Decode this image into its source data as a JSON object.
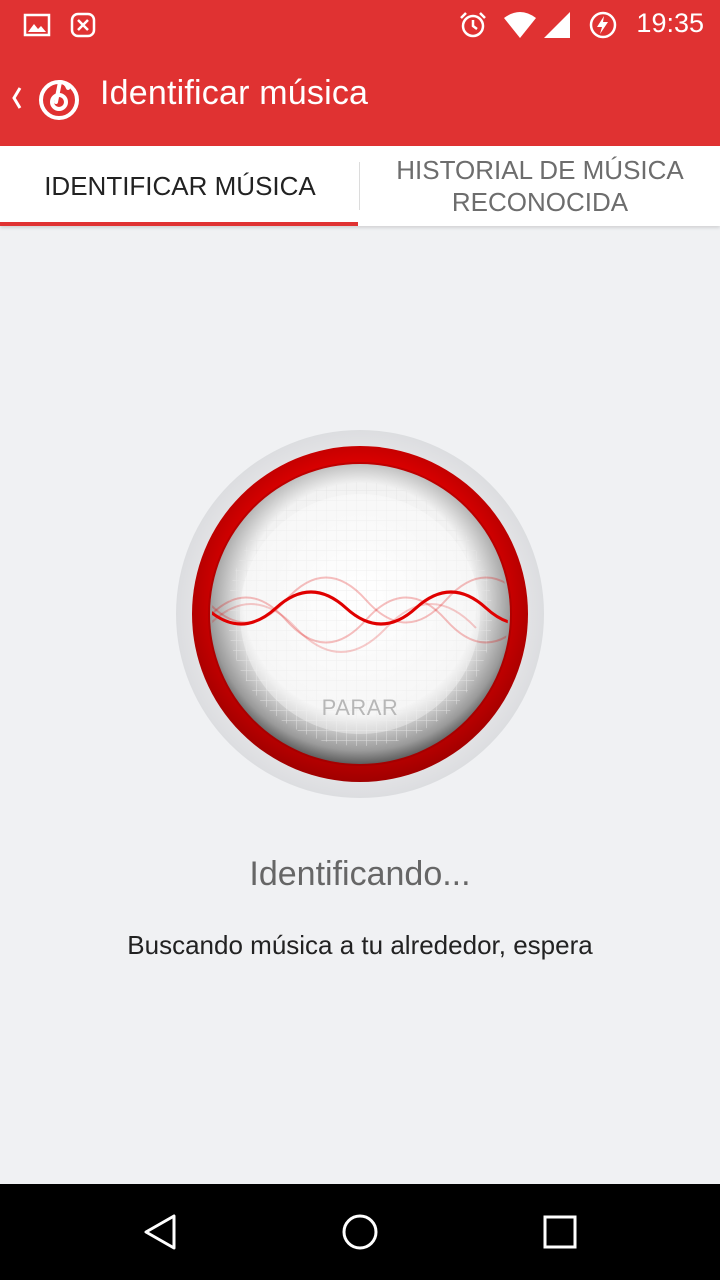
{
  "statusbar": {
    "time": "19:35",
    "icons": [
      "image-notification-icon",
      "app-notification-icon",
      "alarm-icon",
      "wifi-icon",
      "signal-icon",
      "battery-charging-icon"
    ]
  },
  "appbar": {
    "title": "Identificar música",
    "back_icon": "back-chevron-icon",
    "logo_icon": "app-logo-icon",
    "background": "#e03232"
  },
  "tabs": [
    {
      "label": "IDENTIFICAR MÚSICA",
      "active": true
    },
    {
      "label": "HISTORIAL DE MÚSICA RECONOCIDA",
      "active": false
    }
  ],
  "recognizer": {
    "stop_label": "PARAR",
    "accent": "#e00000"
  },
  "status": {
    "title": "Identificando...",
    "subtitle": "Buscando música a tu alrededor, espera"
  },
  "navbar": {
    "icons": [
      "back-triangle-icon",
      "home-circle-icon",
      "recents-square-icon"
    ]
  }
}
